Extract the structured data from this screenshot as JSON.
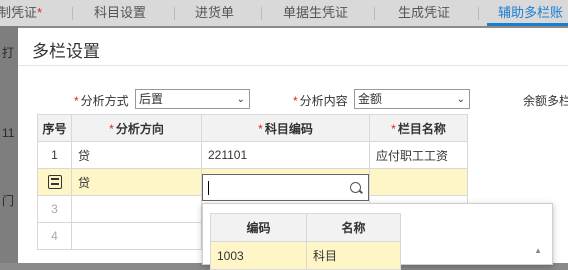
{
  "tabs": [
    {
      "label": "制凭证",
      "star": "*"
    },
    {
      "label": "科目设置"
    },
    {
      "label": "进货单"
    },
    {
      "label": "单据生凭证"
    },
    {
      "label": "生成凭证"
    },
    {
      "label": "辅助多栏账"
    }
  ],
  "background_fragments": [
    "打",
    "11",
    "门"
  ],
  "dialog": {
    "title": "多栏设置",
    "fields": {
      "analysis_method": {
        "label": "分析方式",
        "value": "后置"
      },
      "analysis_content": {
        "label": "分析内容",
        "value": "金额"
      },
      "balance_label": "余额多栏"
    },
    "table": {
      "headers": [
        "序号",
        "分析方向",
        "科目编码",
        "栏目名称"
      ],
      "rows": [
        {
          "num": "1",
          "direction": "贷",
          "code": "221101",
          "name": "应付职工工资"
        },
        {
          "num": "",
          "direction": "贷",
          "code": "",
          "name": ""
        },
        {
          "num": "3",
          "direction": "",
          "code": "",
          "name": ""
        },
        {
          "num": "4",
          "direction": "",
          "code": "",
          "name": ""
        }
      ]
    },
    "dropdown": {
      "headers": [
        "编码",
        "名称"
      ],
      "rows": [
        {
          "code": "1003",
          "name": "科目"
        }
      ]
    }
  },
  "icons": [
    "search-icon",
    "chevron-down-icon",
    "row-edit-icon",
    "scroll-up-icon"
  ],
  "colors": {
    "accent": "#1b7fd1",
    "required": "#e02020",
    "selected_row": "#fff6c8"
  }
}
